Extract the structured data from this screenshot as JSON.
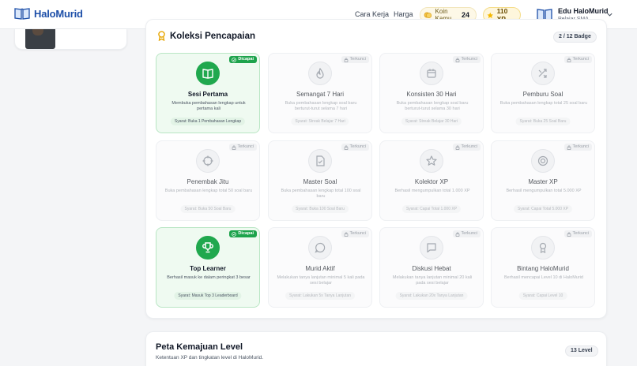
{
  "header": {
    "brand": "HaloMurid",
    "nav": [
      "Cara Kerja",
      "Harga"
    ],
    "coin_label": "Koin Kamu",
    "coin_value": "24",
    "xp_value": "110 XP",
    "user_name": "Edu HaloMurid",
    "user_role": "Pelajar SMA",
    "colors": {
      "brand": "#1d4fa8",
      "coin_bg": "#fdf8e7",
      "xp_bg": "#fef6dc"
    }
  },
  "achievements": {
    "title": "Koleksi Pencapaian",
    "badge_count": "2 / 12 Badge",
    "status_unlocked": "Dicapai",
    "status_locked": "Terkunci",
    "colors": {
      "unlocked": "#20a84e",
      "unlocked_bg": "#effaf1"
    },
    "items": [
      {
        "name": "Sesi Pertama",
        "desc": "Membuka pembahasan lengkap untuk pertama kali",
        "req": "Syarat: Buka 1 Pembahasan Lengkap",
        "unlocked": true,
        "icon": "book-icon"
      },
      {
        "name": "Semangat 7 Hari",
        "desc": "Buka pembahasan lengkap soal baru berturut-turut selama 7 hari",
        "req": "Syarat: Streak Belajar 7 Hari",
        "unlocked": false,
        "icon": "flame-icon"
      },
      {
        "name": "Konsisten 30 Hari",
        "desc": "Buka pembahasan lengkap soal baru berturut-turut selama 30 hari",
        "req": "Syarat: Streak Belajar 30 Hari",
        "unlocked": false,
        "icon": "calendar-icon"
      },
      {
        "name": "Pemburu Soal",
        "desc": "Buka pembahasan lengkap total 25 soal baru",
        "req": "Syarat: Buka 25 Soal Baru",
        "unlocked": false,
        "icon": "shuffle-icon"
      },
      {
        "name": "Penembak Jitu",
        "desc": "Buka pembahasan lengkap total 50 soal baru",
        "req": "Syarat: Buka 50 Soal Baru",
        "unlocked": false,
        "icon": "crosshair-icon"
      },
      {
        "name": "Master Soal",
        "desc": "Buka pembahasan lengkap total 100 soal baru",
        "req": "Syarat: Buka 100 Soal Baru",
        "unlocked": false,
        "icon": "document-icon"
      },
      {
        "name": "Kolektor XP",
        "desc": "Berhasil mengumpulkan total 1.000 XP",
        "req": "Syarat: Capai Total 1.000 XP",
        "unlocked": false,
        "icon": "star-icon"
      },
      {
        "name": "Master XP",
        "desc": "Berhasil mengumpulkan total 5.000 XP",
        "req": "Syarat: Capai Total 5.000 XP",
        "unlocked": false,
        "icon": "target-icon"
      },
      {
        "name": "Top Learner",
        "desc": "Berhasil masuk ke dalam peringkat 3 besar",
        "req": "Syarat: Masuk Top 3 Leaderboard",
        "unlocked": true,
        "icon": "trophy-icon"
      },
      {
        "name": "Murid Aktif",
        "desc": "Melakukan tanya lanjutan minimal 5 kali pada sesi belajar",
        "req": "Syarat: Lakukan 5x Tanya Lanjutan",
        "unlocked": false,
        "icon": "chat-icon"
      },
      {
        "name": "Diskusi Hebat",
        "desc": "Melakukan tanya lanjutan minimal 20 kali pada sesi belajar",
        "req": "Syarat: Lakukan 20x Tanya Lanjutan",
        "unlocked": false,
        "icon": "message-square-icon"
      },
      {
        "name": "Bintang HaloMurid",
        "desc": "Berhasil mencapai Level 10 di HaloMurid",
        "req": "Syarat: Capai Level 10",
        "unlocked": false,
        "icon": "medal-icon"
      }
    ]
  },
  "level_map": {
    "title": "Peta Kemajuan Level",
    "desc": "Ketentuan XP dan tingkatan level di HaloMurid.",
    "count": "13 Level"
  }
}
